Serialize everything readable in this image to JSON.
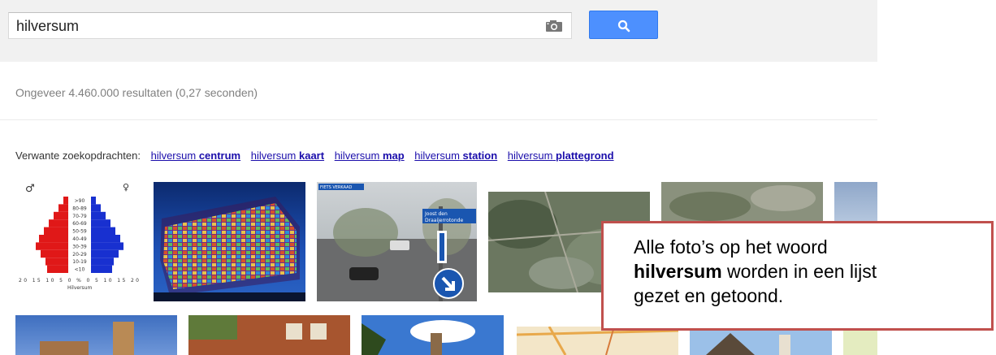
{
  "search": {
    "query": "hilversum"
  },
  "results": {
    "stats": "Ongeveer 4.460.000 resultaten (0,27 seconden)"
  },
  "related": {
    "label": "Verwante zoekopdrachten:",
    "items": [
      {
        "plain": "hilversum",
        "bold": "centrum"
      },
      {
        "plain": "hilversum",
        "bold": "kaart"
      },
      {
        "plain": "hilversum",
        "bold": "map"
      },
      {
        "plain": "hilversum",
        "bold": "station"
      },
      {
        "plain": "hilversum",
        "bold": "plattegrond"
      }
    ]
  },
  "images": {
    "pyramid": {
      "male_symbol": "♂",
      "female_symbol": "♀",
      "ages": [
        ">90",
        "80-89",
        "70-79",
        "60-69",
        "50-59",
        "40-49",
        "30-39",
        "20-29",
        "10-19",
        "<10"
      ],
      "axis": "20 15 10 5 0 % 0 5 10 15 20",
      "caption": "Hilversum"
    },
    "sign": {
      "top": "FIETS VERKAAD",
      "line1": "Joost den",
      "line2": "Draaijerrotonde"
    }
  },
  "callout": {
    "line1": "Alle foto’s op het woord",
    "bold": "hilversum",
    "rest": " worden in een lijst",
    "line3": "gezet en getoond."
  },
  "colors": {
    "button": "#4d90fe",
    "link": "#1a0dab",
    "callout_border": "#c0504d"
  }
}
